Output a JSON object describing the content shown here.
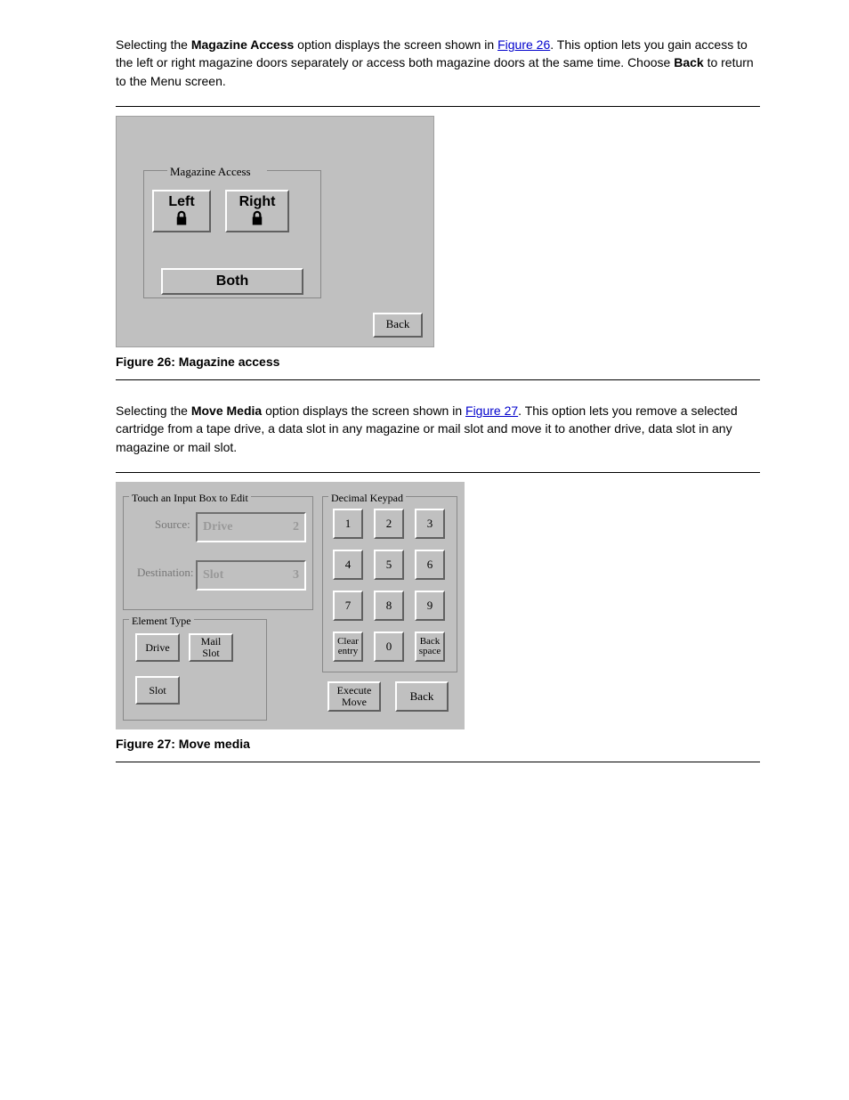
{
  "intro1": {
    "line1_prefix": "Selecting the ",
    "line1_bold": "Magazine Access",
    "line1_suffix": " option displays the screen shown in ",
    "line1_link": "Figure 26",
    "line1_end": ". ",
    "line2": "This option lets you gain access to the left or right magazine doors separately or ",
    "line3_prefix": "access both magazine doors at the same time. Choose ",
    "line3_bold": "Back",
    "line3_suffix": " to return to the ",
    "line4": "Menu screen."
  },
  "fig26": {
    "label": "Figure 26: Magazine access",
    "box_title": "Magazine Access",
    "left": "Left",
    "right": "Right",
    "both": "Both",
    "back": "Back"
  },
  "intro2": {
    "line1_prefix": "Selecting the ",
    "line1_bold": "Move Media",
    "line1_suffix": " option displays the screen shown in ",
    "line1_link": "Figure 27",
    "line1_end": ". This ",
    "line2": "option lets you remove a selected cartridge from a tape drive, a data slot in any ",
    "line3": "magazine or mail slot and move it to another drive, data slot in any magazine or ",
    "line4": "mail slot."
  },
  "fig27": {
    "label": "Figure 27: Move media",
    "g_inputs": "Touch an Input Box to Edit",
    "g_element": "Element Type",
    "g_keypad": "Decimal Keypad",
    "source_label": "Source:",
    "dest_label": "Destination:",
    "source_type": "Drive",
    "source_val": "2",
    "dest_type": "Slot",
    "dest_val": "3",
    "el_drive": "Drive",
    "el_mail": "Mail\nSlot",
    "el_slot": "Slot",
    "keys": [
      "1",
      "2",
      "3",
      "4",
      "5",
      "6",
      "7",
      "8",
      "9",
      "0"
    ],
    "clear": "Clear\nentry",
    "bksp": "Back\nspace",
    "exec": "Execute\nMove",
    "back": "Back"
  }
}
